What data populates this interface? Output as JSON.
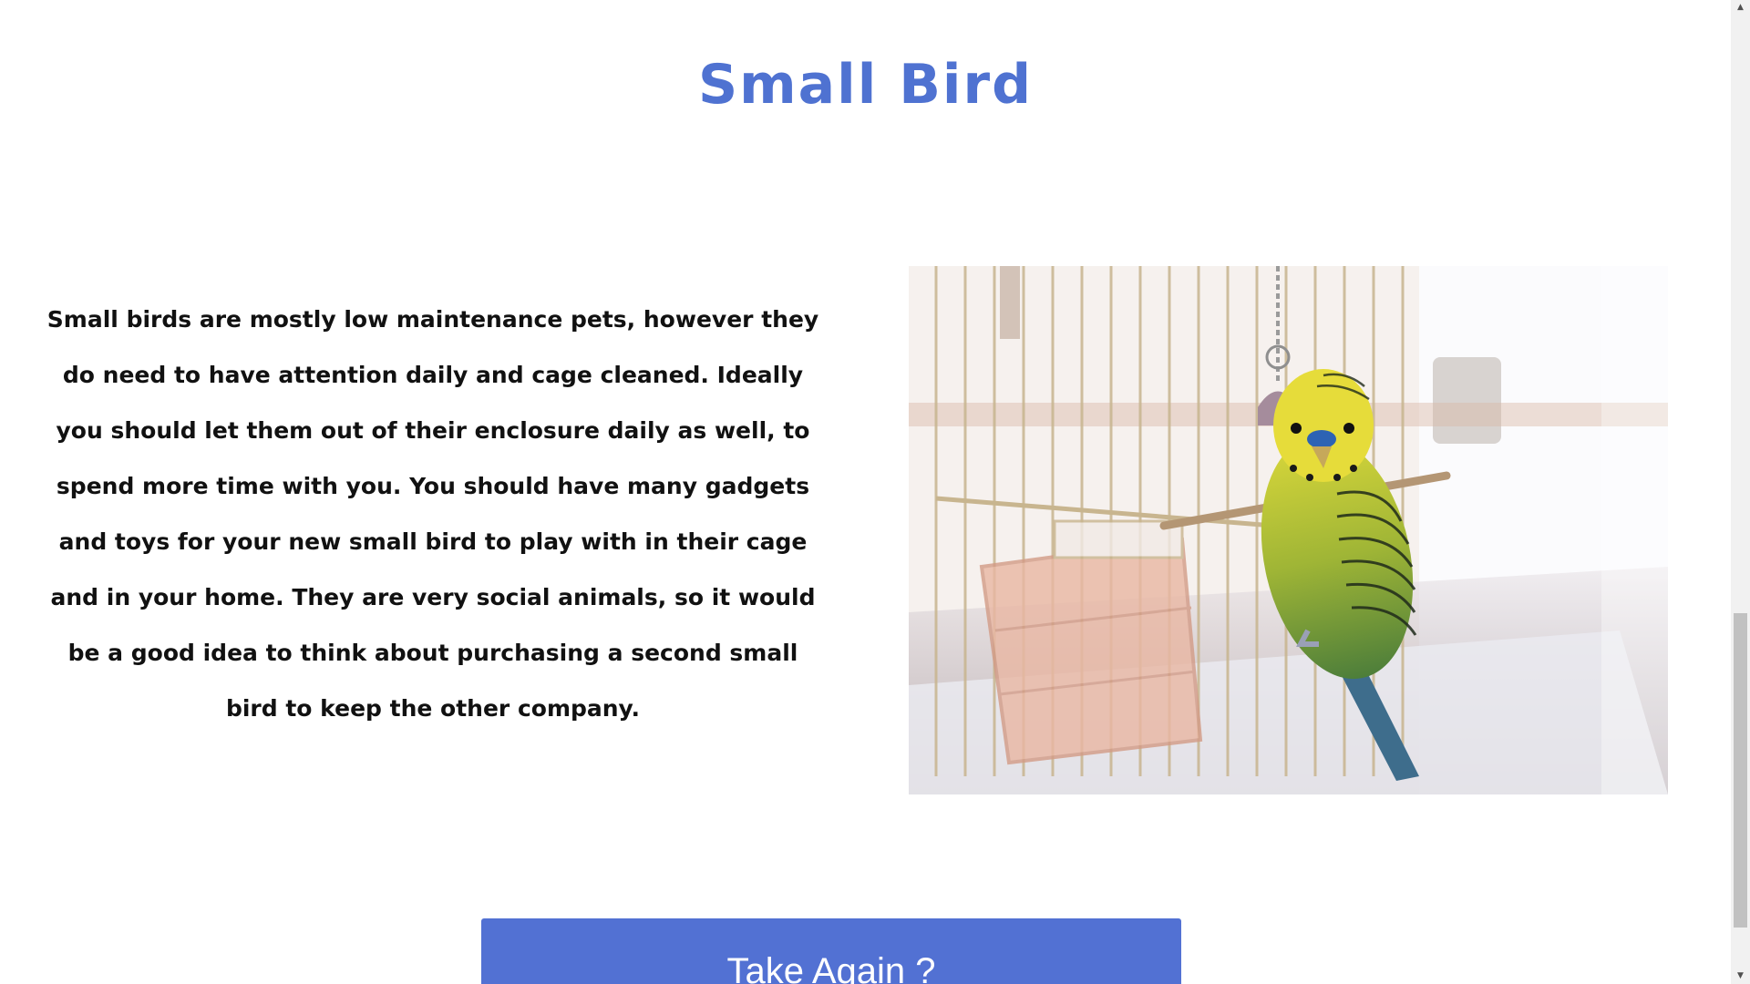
{
  "title": "Small Bird",
  "description": "Small birds are mostly low maintenance pets, however they do need to have attention daily and cage cleaned. Ideally you should let them out of their enclosure daily as well, to spend more time with you. You should have many gadgets and toys for your new small bird to play with in their cage and in your home. They are very social animals, so it would be a good idea to think about purchasing a second small bird to keep the other company.",
  "image": {
    "alt": "Budgerigar in a cage"
  },
  "button": {
    "label": "Take Again ?"
  },
  "colors": {
    "title": "#4f72d1",
    "button": "#5271d3",
    "text": "#111111"
  },
  "scrollbar": {
    "up_icon": "arrow-up-icon",
    "down_icon": "arrow-down-icon"
  }
}
